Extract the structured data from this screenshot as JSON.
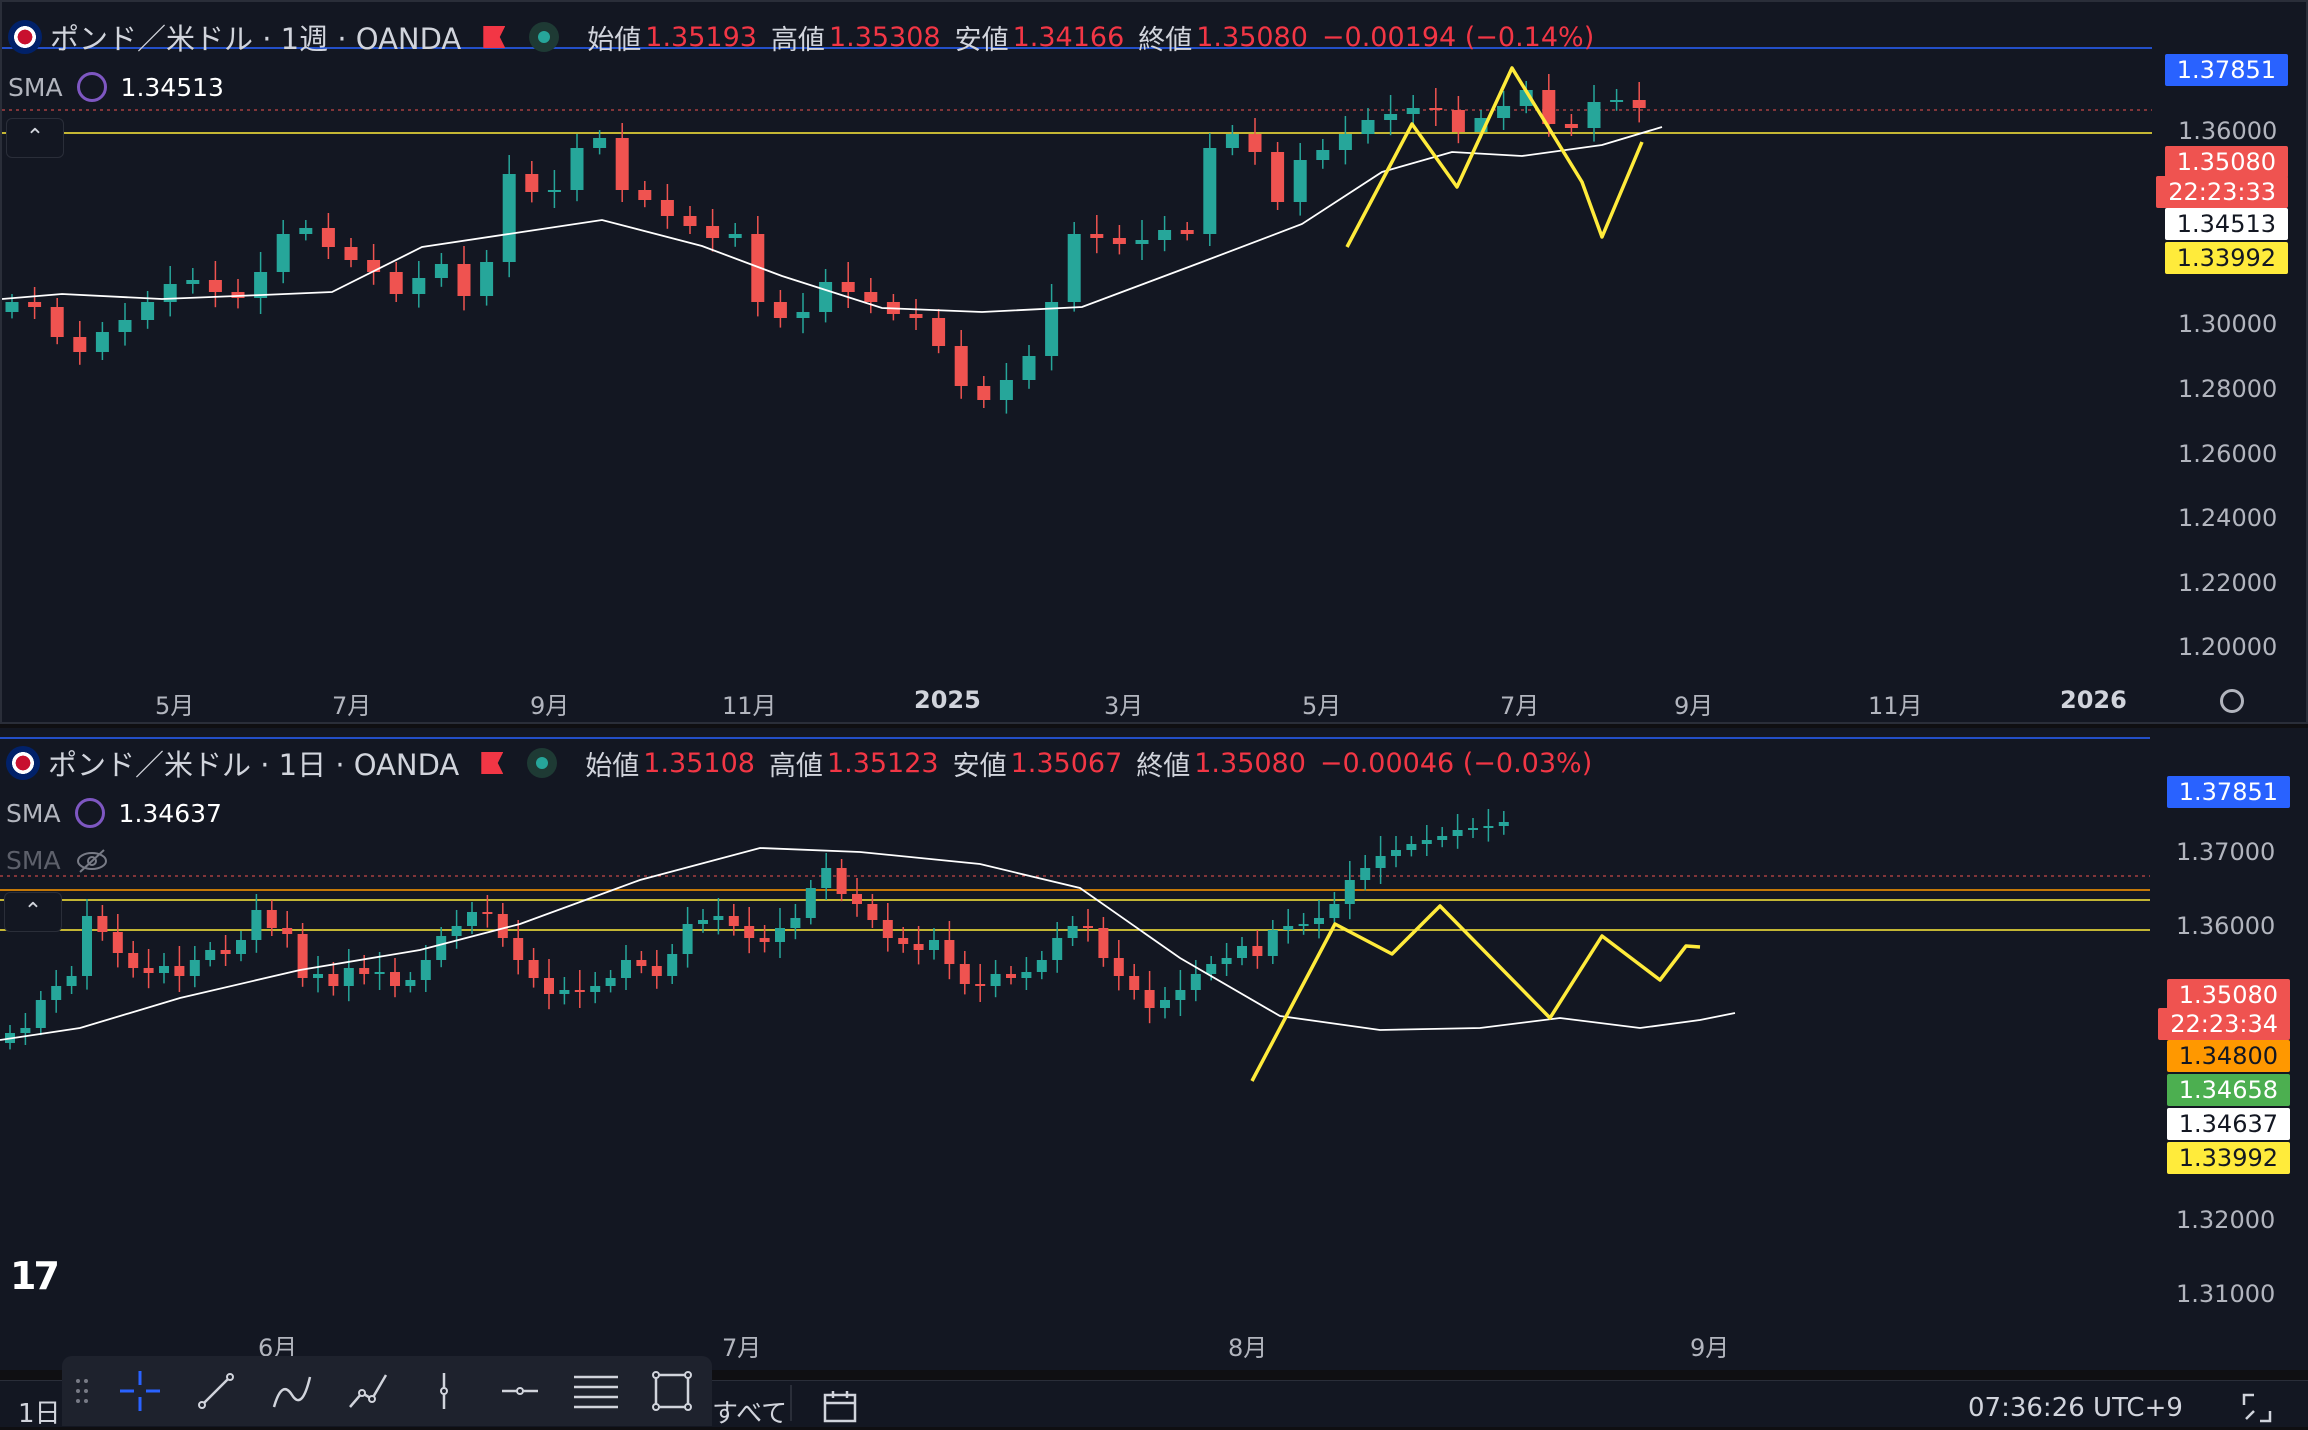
{
  "weekly": {
    "symbol": "ポンド／米ドル · 1週 · OANDA",
    "open_label": "始値",
    "open": "1.35193",
    "high_label": "高値",
    "high": "1.35308",
    "low_label": "安値",
    "low": "1.34166",
    "close_label": "終値",
    "close": "1.35080",
    "change": "−0.00194 (−0.14%)",
    "sma_label": "SMA",
    "sma_value": "1.34513",
    "price_labels": [
      "1.37851",
      "1.35080",
      "22:23:33",
      "1.34513",
      "1.33992"
    ],
    "y_ticks": [
      "1.36000",
      "1.30000",
      "1.28000",
      "1.26000",
      "1.24000",
      "1.22000",
      "1.20000"
    ],
    "x_ticks": [
      "5月",
      "7月",
      "9月",
      "11月",
      "2025",
      "3月",
      "5月",
      "7月",
      "9月",
      "11月",
      "2026"
    ]
  },
  "daily": {
    "symbol": "ポンド／米ドル · 1日 · OANDA",
    "open_label": "始値",
    "open": "1.35108",
    "high_label": "高値",
    "high": "1.35123",
    "low_label": "安値",
    "low": "1.35067",
    "close_label": "終値",
    "close": "1.35080",
    "change": "−0.00046 (−0.03%)",
    "sma_label": "SMA",
    "sma_value": "1.34637",
    "sma2_label": "SMA",
    "price_labels": [
      "1.37851",
      "1.35080",
      "22:23:34",
      "1.34800",
      "1.34658",
      "1.34637",
      "1.33992"
    ],
    "y_ticks": [
      "1.37000",
      "1.36000",
      "1.32000",
      "1.31000"
    ],
    "x_ticks": [
      "6月",
      "7月",
      "8月",
      "9月"
    ]
  },
  "bottom": {
    "interval": "1日",
    "all": "すべて",
    "clock": "07:36:26 UTC+9"
  },
  "colors": {
    "bg": "#131722",
    "up": "#26a69a",
    "down": "#ef5350",
    "hline_blue": "#2962ff",
    "hline_yellow": "#ffeb3b",
    "hline_orange": "#ff9800",
    "sma": "#ffffff",
    "drawing": "#ffeb3b"
  },
  "toolbar_icons": [
    "drag-handle-icon",
    "crosshair-icon",
    "trend-line-icon",
    "curve-icon",
    "path-icon",
    "vertical-line-icon",
    "horizontal-ray-icon",
    "fib-icon",
    "rectangle-icon"
  ]
}
